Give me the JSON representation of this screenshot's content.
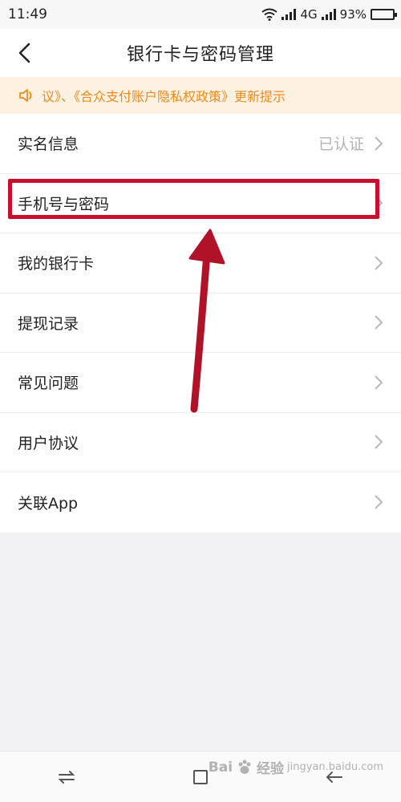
{
  "status_bar": {
    "time": "11:49",
    "network": "4G",
    "battery": "93%",
    "battery_level": 0.93
  },
  "header": {
    "title": "银行卡与密码管理"
  },
  "notice": {
    "text": "议》、《合众支付账户隐私权政策》更新提示"
  },
  "menu": {
    "items": [
      {
        "label": "实名信息",
        "value": "已认证"
      },
      {
        "label": "手机号与密码",
        "value": ""
      },
      {
        "label": "我的银行卡",
        "value": ""
      },
      {
        "label": "提现记录",
        "value": ""
      },
      {
        "label": "常见问题",
        "value": ""
      },
      {
        "label": "用户协议",
        "value": ""
      },
      {
        "label": "关联App",
        "value": ""
      }
    ]
  },
  "watermark": {
    "brand": "Bai",
    "suffix": "经验",
    "domain": "jingyan.baidu.com"
  },
  "colors": {
    "accent": "#f08a1c",
    "notice_bg": "#fdf1e2",
    "highlight": "#c8102e",
    "page_bg": "#f2f2f4"
  }
}
